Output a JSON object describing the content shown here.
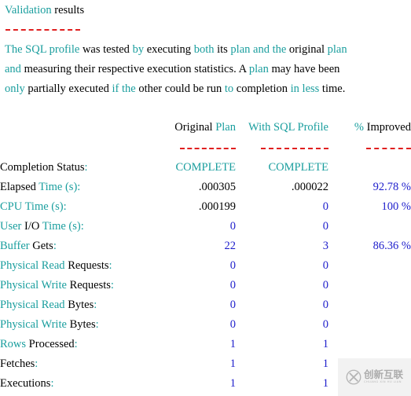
{
  "colors": {
    "teal": "#1a9e9e",
    "black": "#000000",
    "blue": "#2020cc",
    "rule_red": "#e02020",
    "watermark_gray": "#a8a8a8"
  },
  "heading": {
    "word_highlight": "Validation",
    "word_plain": "results"
  },
  "paragraph": {
    "line1": [
      {
        "t": "The SQL profile",
        "c": "teal"
      },
      {
        "t": " was tested",
        "c": "black"
      },
      {
        "t": " by",
        "c": "teal"
      },
      {
        "t": " executing",
        "c": "black"
      },
      {
        "t": " both",
        "c": "teal"
      },
      {
        "t": " its",
        "c": "black"
      },
      {
        "t": " plan and the",
        "c": "teal"
      },
      {
        "t": " original",
        "c": "black"
      },
      {
        "t": " plan",
        "c": "teal"
      }
    ],
    "line2": [
      {
        "t": "and",
        "c": "teal"
      },
      {
        "t": " measuring their respective execution statistics. A",
        "c": "black"
      },
      {
        "t": " plan",
        "c": "teal"
      },
      {
        "t": " may have been",
        "c": "black"
      }
    ],
    "line3": [
      {
        "t": "only",
        "c": "teal"
      },
      {
        "t": " partially executed",
        "c": "black"
      },
      {
        "t": " if the",
        "c": "teal"
      },
      {
        "t": " other could be run",
        "c": "black"
      },
      {
        "t": " to",
        "c": "teal"
      },
      {
        "t": " completion",
        "c": "black"
      },
      {
        "t": " in less",
        "c": "teal"
      },
      {
        "t": " time.",
        "c": "black"
      }
    ]
  },
  "table": {
    "headers": [
      {
        "parts": [
          {
            "t": "Original ",
            "c": "black"
          },
          {
            "t": "Plan",
            "c": "teal"
          }
        ]
      },
      {
        "parts": [
          {
            "t": "With SQL Profile",
            "c": "teal"
          }
        ]
      },
      {
        "parts": [
          {
            "t": "% ",
            "c": "teal"
          },
          {
            "t": "Improved",
            "c": "black"
          }
        ]
      }
    ],
    "rows": [
      {
        "label": [
          {
            "t": "Completion Status",
            "c": "black"
          },
          {
            "t": ":",
            "c": "teal"
          }
        ],
        "original": [
          {
            "t": "COMPLETE",
            "c": "teal"
          }
        ],
        "profile": [
          {
            "t": "COMPLETE",
            "c": "teal"
          }
        ],
        "improved": []
      },
      {
        "label": [
          {
            "t": "Elapsed ",
            "c": "black"
          },
          {
            "t": "Time (s):",
            "c": "teal"
          }
        ],
        "original": [
          {
            "t": ".000305",
            "c": "black"
          }
        ],
        "profile": [
          {
            "t": ".000022",
            "c": "black"
          }
        ],
        "improved": [
          {
            "t": "92.78 %",
            "c": "blue"
          }
        ]
      },
      {
        "label": [
          {
            "t": "CPU Time ",
            "c": "teal"
          },
          {
            "t": "(s):",
            "c": "teal"
          }
        ],
        "original": [
          {
            "t": ".000199",
            "c": "black"
          }
        ],
        "profile": [
          {
            "t": "0",
            "c": "blue"
          }
        ],
        "improved": [
          {
            "t": "100 %",
            "c": "blue"
          }
        ]
      },
      {
        "label": [
          {
            "t": "User ",
            "c": "teal"
          },
          {
            "t": "I/O ",
            "c": "black"
          },
          {
            "t": "Time (s):",
            "c": "teal"
          }
        ],
        "original": [
          {
            "t": "0",
            "c": "blue"
          }
        ],
        "profile": [
          {
            "t": "0",
            "c": "blue"
          }
        ],
        "improved": []
      },
      {
        "label": [
          {
            "t": "Buffer ",
            "c": "teal"
          },
          {
            "t": "Gets",
            "c": "black"
          },
          {
            "t": ":",
            "c": "teal"
          }
        ],
        "original": [
          {
            "t": "22",
            "c": "blue"
          }
        ],
        "profile": [
          {
            "t": "3",
            "c": "blue"
          }
        ],
        "improved": [
          {
            "t": "86.36 %",
            "c": "blue"
          }
        ]
      },
      {
        "label": [
          {
            "t": "Physical Read ",
            "c": "teal"
          },
          {
            "t": "Requests",
            "c": "black"
          },
          {
            "t": ":",
            "c": "teal"
          }
        ],
        "original": [
          {
            "t": "0",
            "c": "blue"
          }
        ],
        "profile": [
          {
            "t": "0",
            "c": "blue"
          }
        ],
        "improved": []
      },
      {
        "label": [
          {
            "t": "Physical Write ",
            "c": "teal"
          },
          {
            "t": "Requests",
            "c": "black"
          },
          {
            "t": ":",
            "c": "teal"
          }
        ],
        "original": [
          {
            "t": "0",
            "c": "blue"
          }
        ],
        "profile": [
          {
            "t": "0",
            "c": "blue"
          }
        ],
        "improved": []
      },
      {
        "label": [
          {
            "t": "Physical Read ",
            "c": "teal"
          },
          {
            "t": "Bytes",
            "c": "black"
          },
          {
            "t": ":",
            "c": "teal"
          }
        ],
        "original": [
          {
            "t": "0",
            "c": "blue"
          }
        ],
        "profile": [
          {
            "t": "0",
            "c": "blue"
          }
        ],
        "improved": []
      },
      {
        "label": [
          {
            "t": "Physical Write ",
            "c": "teal"
          },
          {
            "t": "Bytes",
            "c": "black"
          },
          {
            "t": ":",
            "c": "teal"
          }
        ],
        "original": [
          {
            "t": "0",
            "c": "blue"
          }
        ],
        "profile": [
          {
            "t": "0",
            "c": "blue"
          }
        ],
        "improved": []
      },
      {
        "label": [
          {
            "t": "Rows ",
            "c": "teal"
          },
          {
            "t": "Processed",
            "c": "black"
          },
          {
            "t": ":",
            "c": "teal"
          }
        ],
        "original": [
          {
            "t": "1",
            "c": "blue"
          }
        ],
        "profile": [
          {
            "t": "1",
            "c": "blue"
          }
        ],
        "improved": []
      },
      {
        "label": [
          {
            "t": "Fetches",
            "c": "black"
          },
          {
            "t": ":",
            "c": "teal"
          }
        ],
        "original": [
          {
            "t": "1",
            "c": "blue"
          }
        ],
        "profile": [
          {
            "t": "1",
            "c": "blue"
          }
        ],
        "improved": []
      },
      {
        "label": [
          {
            "t": "Executions",
            "c": "black"
          },
          {
            "t": ":",
            "c": "teal"
          }
        ],
        "original": [
          {
            "t": "1",
            "c": "blue"
          }
        ],
        "profile": [
          {
            "t": "1",
            "c": "blue"
          }
        ],
        "improved": []
      }
    ]
  },
  "watermark": {
    "cn": "创新互联",
    "en": "CHUANG XIN HU LIAN"
  }
}
